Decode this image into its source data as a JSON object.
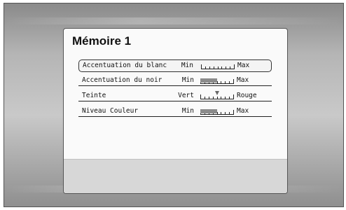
{
  "menu": {
    "title": "Mémoire 1",
    "rows": [
      {
        "label": "Accentuation du blanc",
        "min": "Min",
        "max": "Max",
        "level": 0.0,
        "mode": "fill"
      },
      {
        "label": "Accentuation du noir",
        "min": "Min",
        "max": "Max",
        "level": 0.5,
        "mode": "fill"
      },
      {
        "label": "Teinte",
        "min": "Vert",
        "max": "Rouge",
        "level": 0.5,
        "mode": "marker"
      },
      {
        "label": "Niveau Couleur",
        "min": "Min",
        "max": "Max",
        "level": 0.5,
        "mode": "fill"
      }
    ]
  },
  "colors": {
    "fill": "#8b8b8b",
    "selection_border": "#333333"
  }
}
